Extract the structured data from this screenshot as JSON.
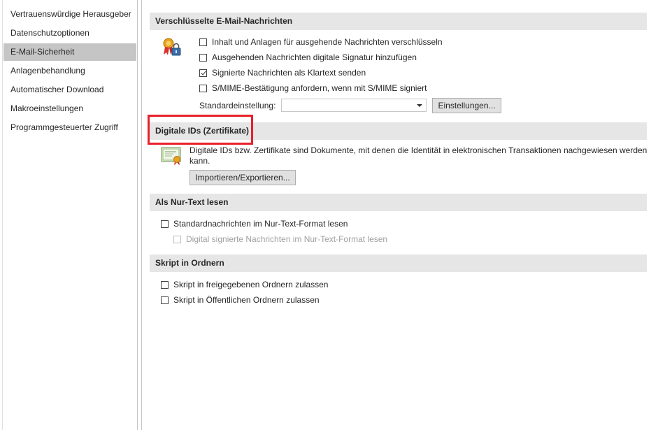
{
  "sidebar": {
    "items": [
      {
        "label": "Vertrauenswürdige Herausgeber"
      },
      {
        "label": "Datenschutzoptionen"
      },
      {
        "label": "E-Mail-Sicherheit"
      },
      {
        "label": "Anlagenbehandlung"
      },
      {
        "label": "Automatischer Download"
      },
      {
        "label": "Makroeinstellungen"
      },
      {
        "label": "Programmgesteuerter Zugriff"
      }
    ],
    "selected_index": 2
  },
  "encrypted": {
    "header": "Verschlüsselte E-Mail-Nachrichten",
    "icon": "certificate-lock-icon",
    "options": [
      {
        "label": "Inhalt und Anlagen für ausgehende Nachrichten verschlüsseln",
        "checked": false
      },
      {
        "label": "Ausgehenden Nachrichten digitale Signatur hinzufügen",
        "checked": false
      },
      {
        "label": "Signierte Nachrichten als Klartext senden",
        "checked": true
      },
      {
        "label": "S/MIME-Bestätigung anfordern, wenn mit S/MIME signiert",
        "checked": false
      }
    ],
    "default_setting_label": "Standardeinstellung:",
    "default_setting_value": "",
    "settings_button": "Einstellungen..."
  },
  "digital_ids": {
    "header": "Digitale IDs (Zertifikate)",
    "icon": "certificate-icon",
    "description": "Digitale IDs bzw. Zertifikate sind Dokumente, mit denen die Identität in elektronischen Transaktionen nachgewiesen werden kann.",
    "import_export_button": "Importieren/Exportieren...",
    "highlight_color": "#e8202a"
  },
  "plain_text": {
    "header": "Als Nur-Text lesen",
    "options": [
      {
        "label": "Standardnachrichten im Nur-Text-Format lesen",
        "checked": false,
        "disabled": false
      },
      {
        "label": "Digital signierte Nachrichten im Nur-Text-Format lesen",
        "checked": false,
        "disabled": true
      }
    ]
  },
  "script": {
    "header": "Skript in Ordnern",
    "options": [
      {
        "label": "Skript in freigegebenen Ordnern zulassen",
        "checked": false
      },
      {
        "label": "Skript in Öffentlichen Ordnern zulassen",
        "checked": false
      }
    ]
  }
}
